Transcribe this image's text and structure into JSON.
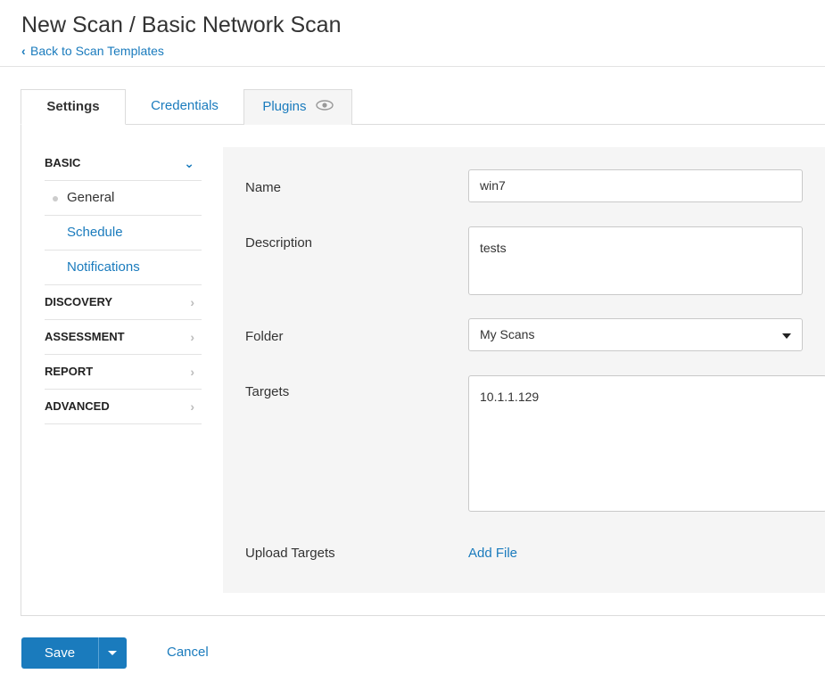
{
  "header": {
    "title": "New Scan / Basic Network Scan",
    "back_link": "Back to Scan Templates"
  },
  "tabs": [
    {
      "label": "Settings",
      "active": true
    },
    {
      "label": "Credentials",
      "active": false
    },
    {
      "label": "Plugins",
      "active": false,
      "icon": "eye-icon"
    }
  ],
  "sidebar": {
    "sections": [
      {
        "label": "BASIC",
        "expanded": true,
        "icon": "chevron-down-icon"
      },
      {
        "label": "DISCOVERY",
        "expanded": false,
        "icon": "chevron-right-icon"
      },
      {
        "label": "ASSESSMENT",
        "expanded": false,
        "icon": "chevron-right-icon"
      },
      {
        "label": "REPORT",
        "expanded": false,
        "icon": "chevron-right-icon"
      },
      {
        "label": "ADVANCED",
        "expanded": false,
        "icon": "chevron-right-icon"
      }
    ],
    "basic_items": [
      {
        "label": "General",
        "active": true
      },
      {
        "label": "Schedule",
        "active": false
      },
      {
        "label": "Notifications",
        "active": false
      }
    ]
  },
  "form": {
    "name": {
      "label": "Name",
      "value": "win7"
    },
    "description": {
      "label": "Description",
      "value": "tests"
    },
    "folder": {
      "label": "Folder",
      "value": "My Scans"
    },
    "targets": {
      "label": "Targets",
      "value": "10.1.1.129"
    },
    "upload_targets": {
      "label": "Upload Targets",
      "link": "Add File"
    }
  },
  "footer": {
    "save_label": "Save",
    "cancel_label": "Cancel"
  },
  "colors": {
    "accent": "#1a7bbd",
    "panel_bg": "#f5f5f5",
    "border": "#dcdcdc"
  }
}
